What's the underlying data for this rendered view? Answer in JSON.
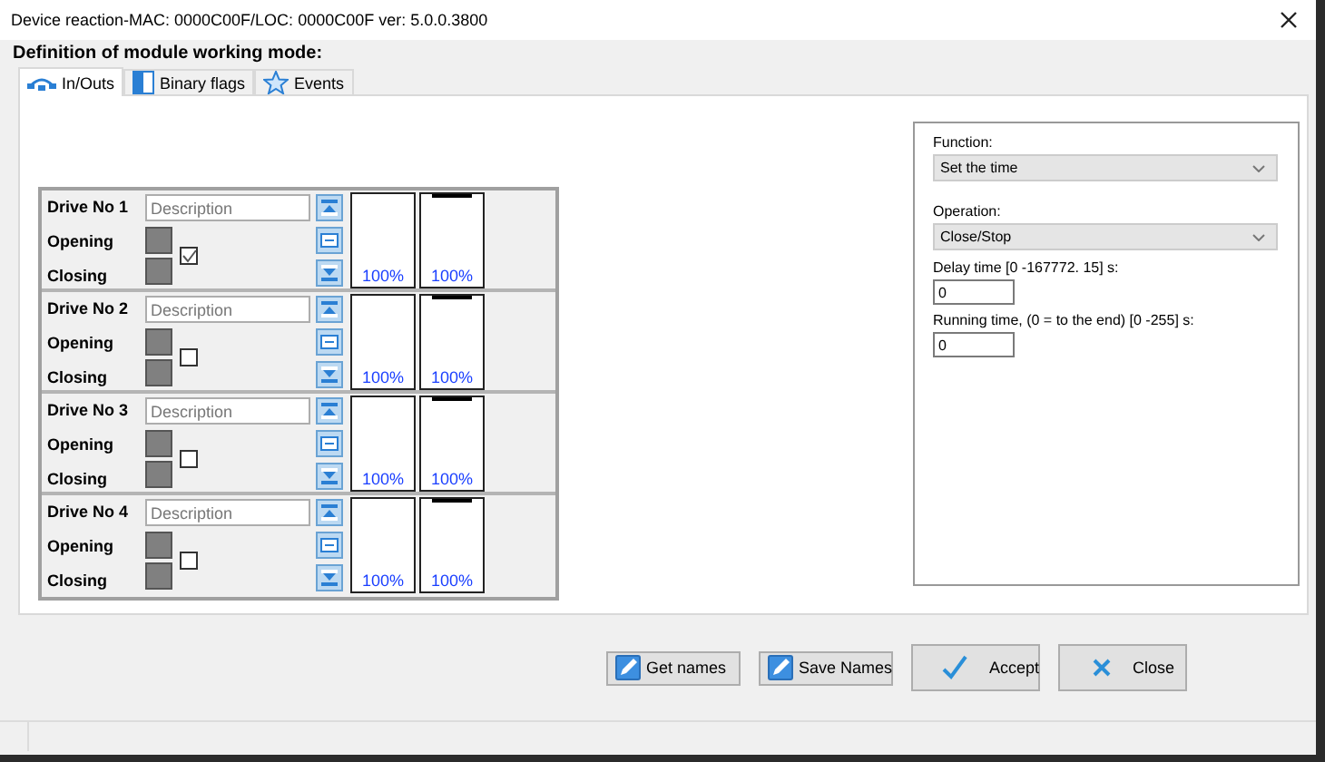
{
  "window": {
    "title": "Device reaction-MAC: 0000C00F/LOC: 0000C00F ver: 5.0.0.3800"
  },
  "heading": "Definition of module working mode:",
  "tabs": [
    {
      "label": "In/Outs",
      "selected": true,
      "kind": "cable"
    },
    {
      "label": "Binary flags",
      "selected": false,
      "kind": "flags"
    },
    {
      "label": "Events",
      "selected": false,
      "kind": "star"
    }
  ],
  "drives": [
    {
      "name": "Drive No 1",
      "placeholder": "Description",
      "opening": "Opening",
      "closing": "Closing",
      "checked": true,
      "meters": [
        {
          "reading": "100%"
        },
        {
          "reading": "100%",
          "level": 1
        }
      ]
    },
    {
      "name": "Drive No 2",
      "placeholder": "Description",
      "opening": "Opening",
      "closing": "Closing",
      "checked": false,
      "meters": [
        {
          "reading": "100%"
        },
        {
          "reading": "100%",
          "level": 1
        }
      ]
    },
    {
      "name": "Drive No 3",
      "placeholder": "Description",
      "opening": "Opening",
      "closing": "Closing",
      "checked": false,
      "meters": [
        {
          "reading": "100%"
        },
        {
          "reading": "100%",
          "level": 1
        }
      ]
    },
    {
      "name": "Drive No 4",
      "placeholder": "Description",
      "opening": "Opening",
      "closing": "Closing",
      "checked": false,
      "meters": [
        {
          "reading": "100%"
        },
        {
          "reading": "100%",
          "level": 1
        }
      ]
    }
  ],
  "settings": {
    "function_label": "Function:",
    "function_value": "Set the time",
    "operation_label": "Operation:",
    "operation_value": "Close/Stop",
    "delay_label": "Delay time [0 -167772. 15] s:",
    "delay_value": "0",
    "running_label": "Running time, (0 = to the end) [0 -255] s:",
    "running_value": "0"
  },
  "buttons": [
    {
      "label": "Get names",
      "kind": "tool"
    },
    {
      "label": "Save Names",
      "kind": "tool"
    },
    {
      "label": "Accept",
      "kind": "confirm"
    },
    {
      "label": "Close",
      "kind": "cancel"
    }
  ]
}
